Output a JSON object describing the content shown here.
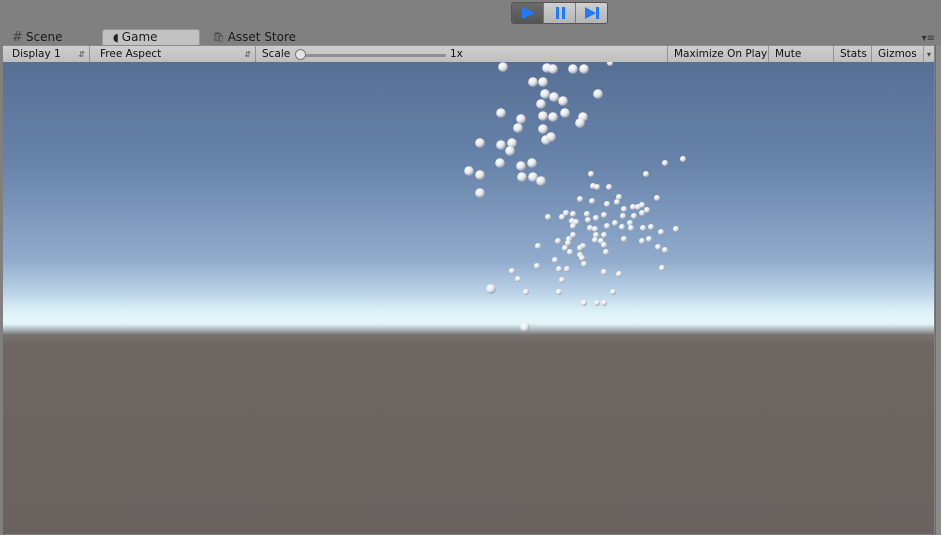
{
  "play_controls": {
    "play_icon": "play-icon",
    "pause_icon": "pause-icon",
    "step_icon": "step-icon",
    "accent_color": "#1e7bff",
    "playing": true
  },
  "tabs": [
    {
      "label": "Scene",
      "icon": "grid-hash-icon",
      "active": false
    },
    {
      "label": "Game",
      "icon": "pacman-icon",
      "active": true
    },
    {
      "label": "Asset Store",
      "icon": "shopping-bag-icon",
      "active": false
    }
  ],
  "toolbar": {
    "display": "Display 1",
    "aspect": "Free Aspect",
    "scale_label": "Scale",
    "scale_value": "1x",
    "maximize_on_play": "Maximize On Play",
    "mute_audio": "Mute Audio",
    "stats": "Stats",
    "gizmos": "Gizmos"
  },
  "colors": {
    "sky_top": "#566f95",
    "horizon": "#e3f6f9",
    "ground": "#6a625f"
  }
}
